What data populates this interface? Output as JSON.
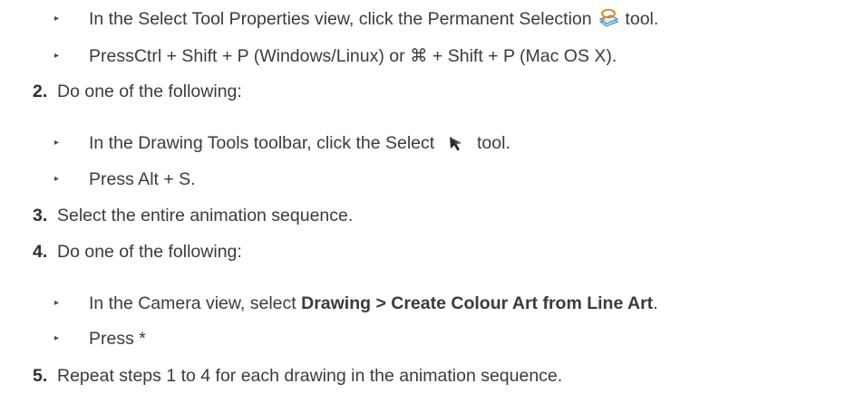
{
  "steps": {
    "s1_bullet1": {
      "before": "In the Select Tool Properties view, click the Permanent Selection ",
      "after": " tool.",
      "icon": "permanent-selection-icon"
    },
    "s1_bullet2": {
      "before": "PressCtrl + Shift + P (Windows/Linux) or ",
      "cmd_symbol": "⌘",
      "after": " + Shift + P (Mac OS X)."
    },
    "step2": {
      "number": "2.",
      "text": "Do one of the following:"
    },
    "s2_bullet1": {
      "before": "In the Drawing Tools toolbar, click the Select ",
      "after": " tool.",
      "icon": "select-arrow-icon"
    },
    "s2_bullet2": {
      "text": "Press Alt + S."
    },
    "step3": {
      "number": "3.",
      "text": "Select the entire animation sequence."
    },
    "step4": {
      "number": "4.",
      "text": "Do one of the following:"
    },
    "s4_bullet1": {
      "before": "In the Camera view, select ",
      "bold": "Drawing > Create Colour Art from Line Art",
      "after": "."
    },
    "s4_bullet2": {
      "text": "Press *"
    },
    "step5": {
      "number": "5.",
      "text": "Repeat steps 1 to 4 for each drawing in the animation sequence."
    }
  },
  "bullet_glyph": "▸"
}
